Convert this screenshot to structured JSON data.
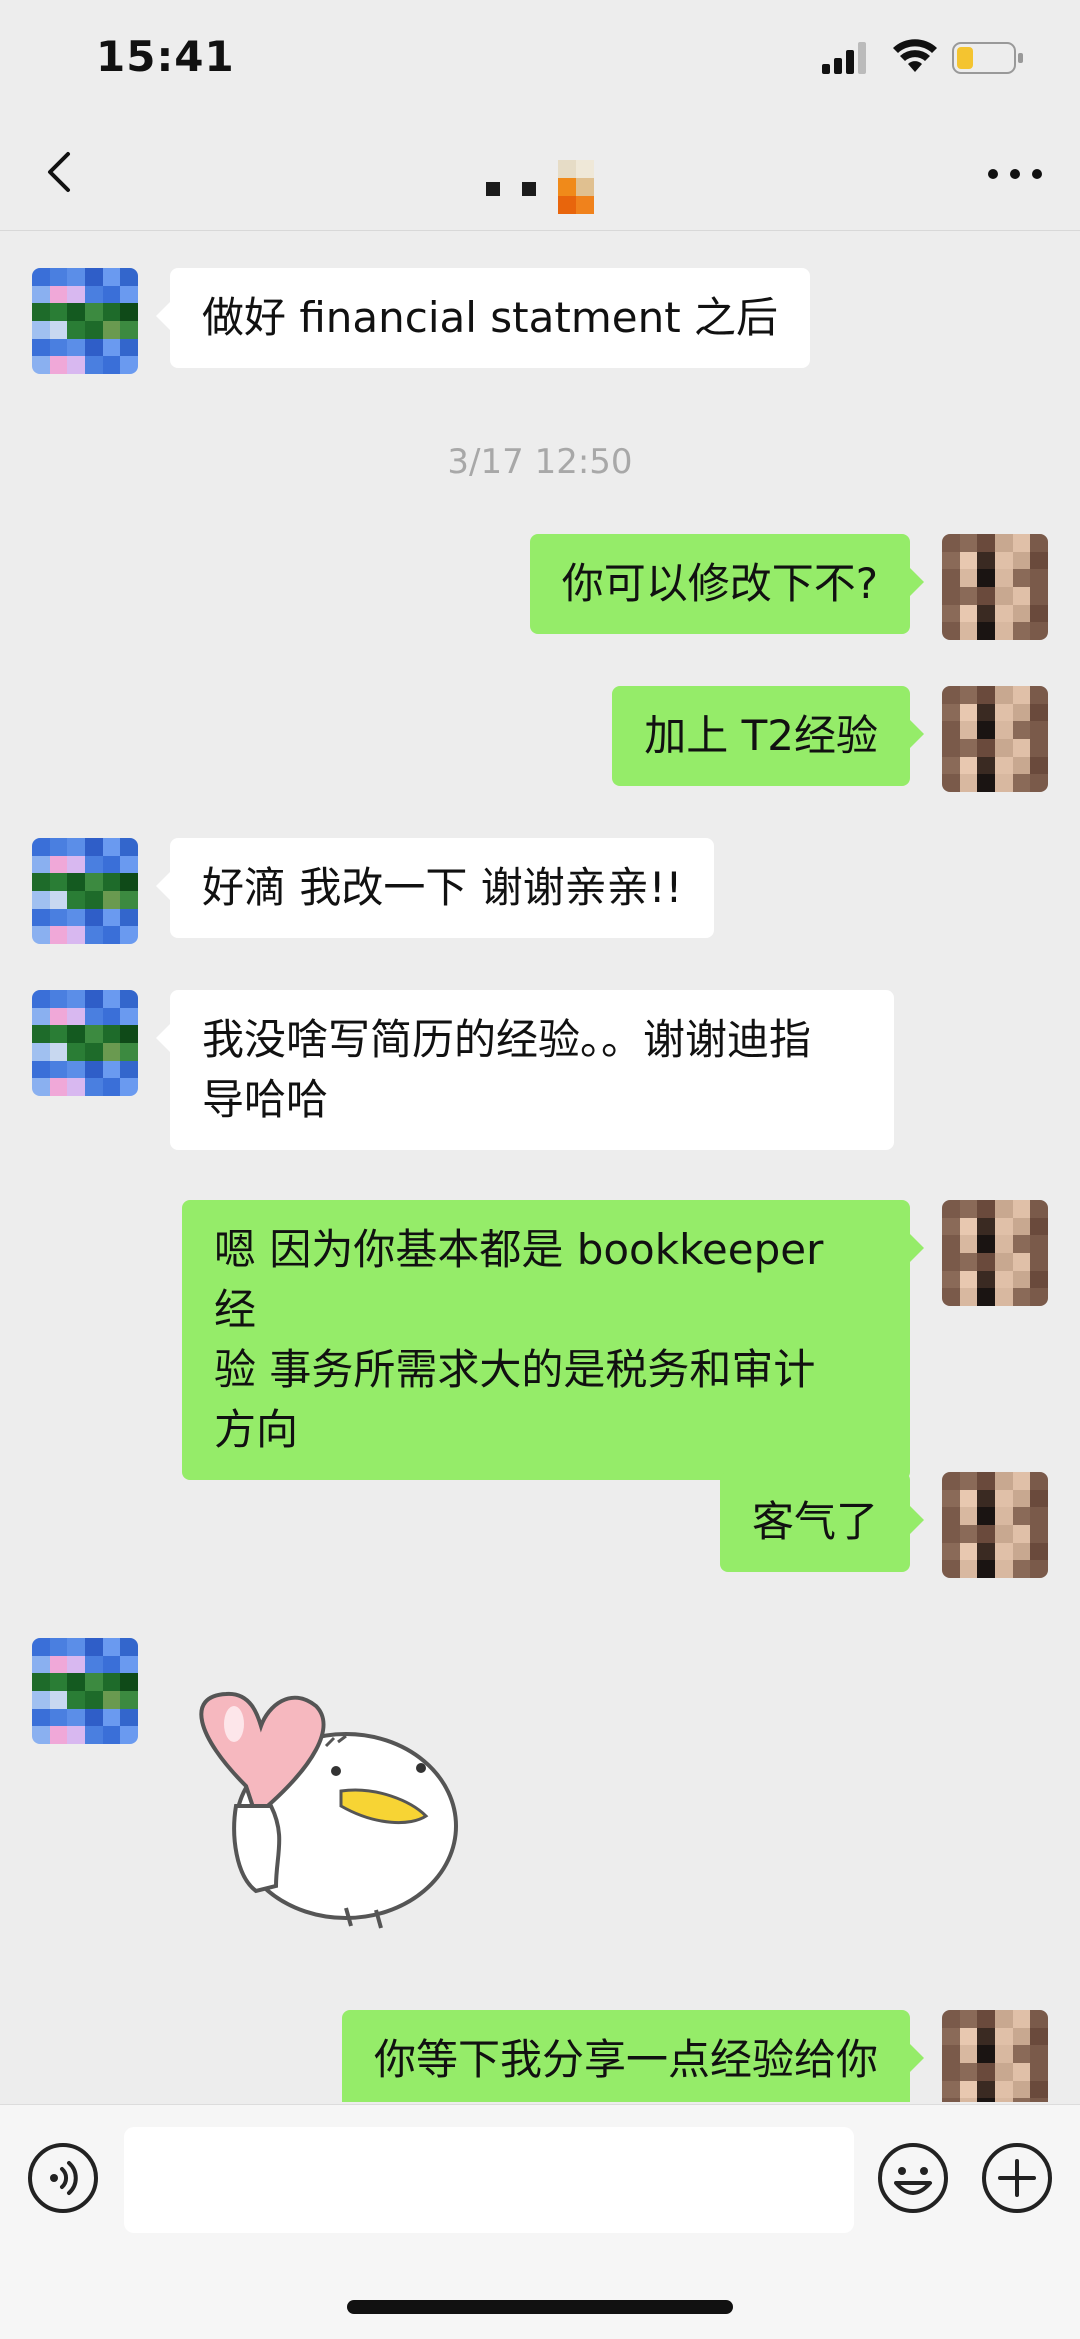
{
  "status": {
    "time": "15:41"
  },
  "header": {
    "title_obscured": "pixelated contact name",
    "back_icon": "chevron-left-icon",
    "more_icon": "ellipsis-icon"
  },
  "messages": [
    {
      "side": "in",
      "text": "做好 financial statment 之后"
    },
    {
      "type": "timestamp",
      "text": "3/17 12:50"
    },
    {
      "side": "out",
      "text": "你可以修改下不?"
    },
    {
      "side": "out",
      "text": "加上 T2经验"
    },
    {
      "side": "in",
      "text": "好滴 我改一下 谢谢亲亲!!"
    },
    {
      "side": "in",
      "text": "我没啥写简历的经验。。谢谢迪指\n导哈哈"
    },
    {
      "side": "out",
      "text": "嗯 因为你基本都是 bookkeeper 经\n验 事务所需求大的是税务和审计\n方向"
    },
    {
      "side": "out",
      "text": "客气了"
    },
    {
      "side": "in",
      "type": "sticker",
      "sticker": "duck-holding-heart-sticker"
    },
    {
      "side": "out",
      "text": "你等下我分享一点经验给你"
    }
  ],
  "input_bar": {
    "voice_icon": "voice-icon",
    "emoji_icon": "emoji-icon",
    "plus_icon": "plus-icon",
    "text_value": ""
  },
  "colors": {
    "background": "#ededed",
    "outgoing_bubble": "#95ec69",
    "incoming_bubble": "#ffffff",
    "battery": "#f4c430"
  }
}
